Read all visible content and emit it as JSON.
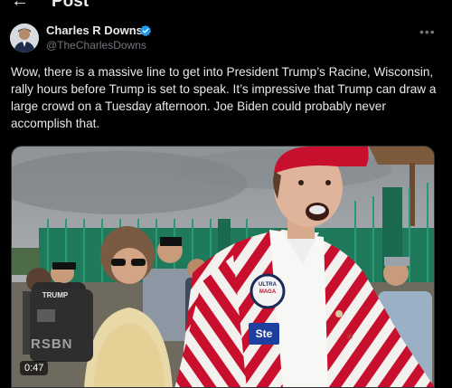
{
  "header": {
    "back_icon": "arrow-left-icon",
    "title": "Post"
  },
  "author": {
    "name": "Charles R Downs",
    "handle": "@TheCharlesDowns",
    "verified": true,
    "verified_color": "#1d9bf0",
    "more_icon": "more-horizontal-icon"
  },
  "tweet": {
    "text": "Wow, there is a massive line to get into President Trump’s Racine, Wisconsin, rally hours before Trump is set to speak. It’s impressive that Trump can draw a large crowd on a Tuesday afternoon. Joe Biden could probably never accomplish that."
  },
  "video": {
    "duration": "0:47",
    "watermark": "RSBN",
    "badge_ultra": "ULTRA",
    "badge_maga": "MAGA",
    "badge_ste": "Ste",
    "shirt_text": "TRUMP",
    "colors": {
      "hat_red": "#c8102e",
      "fence_green": "#1f7a5c",
      "sky": "#a9adb1"
    }
  }
}
